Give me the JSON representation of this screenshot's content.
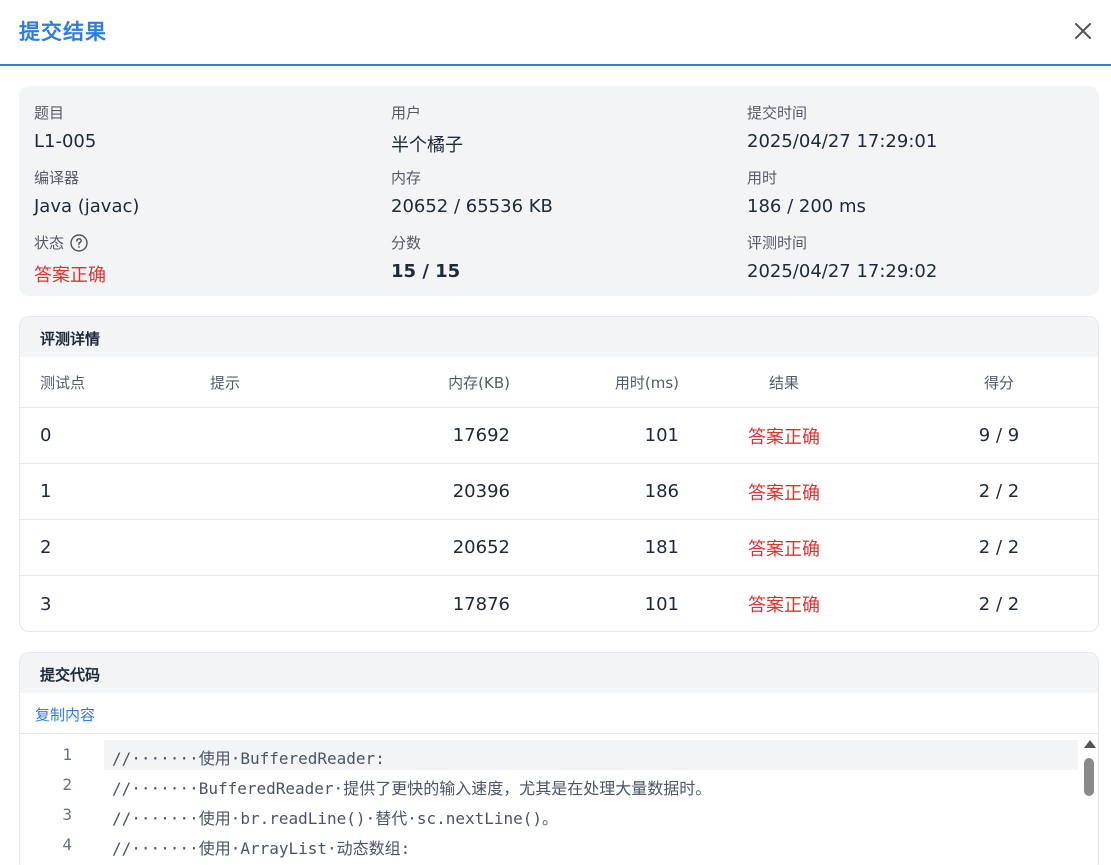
{
  "header": {
    "title": "提交结果",
    "close_icon": "close-icon"
  },
  "info": {
    "problem": {
      "label": "题目",
      "value": "L1-005"
    },
    "user": {
      "label": "用户",
      "value": "半个橘子"
    },
    "submit_time": {
      "label": "提交时间",
      "value": "2025/04/27 17:29:01"
    },
    "compiler": {
      "label": "编译器",
      "value": "Java (javac)"
    },
    "memory": {
      "label": "内存",
      "value": "20652 / 65536 KB"
    },
    "time_used": {
      "label": "用时",
      "value": "186 / 200 ms"
    },
    "status": {
      "label": "状态",
      "value": "答案正确",
      "help_icon": "help-icon"
    },
    "score": {
      "label": "分数",
      "value": "15 / 15"
    },
    "judge_time": {
      "label": "评测时间",
      "value": "2025/04/27 17:29:02"
    }
  },
  "judge_details": {
    "title": "评测详情",
    "headers": {
      "case": "测试点",
      "hint": "提示",
      "memory": "内存(KB)",
      "time": "用时(ms)",
      "result": "结果",
      "score": "得分"
    },
    "rows": [
      {
        "case": "0",
        "hint": "",
        "memory": "17692",
        "time": "101",
        "result": "答案正确",
        "score": "9 / 9"
      },
      {
        "case": "1",
        "hint": "",
        "memory": "20396",
        "time": "186",
        "result": "答案正确",
        "score": "2 / 2"
      },
      {
        "case": "2",
        "hint": "",
        "memory": "20652",
        "time": "181",
        "result": "答案正确",
        "score": "2 / 2"
      },
      {
        "case": "3",
        "hint": "",
        "memory": "17876",
        "time": "101",
        "result": "答案正确",
        "score": "2 / 2"
      }
    ]
  },
  "code": {
    "title": "提交代码",
    "copy_label": "复制内容",
    "lines": [
      {
        "num": "1",
        "text": "//·······使用·BufferedReader:"
      },
      {
        "num": "2",
        "text": "//·······BufferedReader·提供了更快的输入速度，尤其是在处理大量数据时。"
      },
      {
        "num": "3",
        "text": "//·······使用·br.readLine()·替代·sc.nextLine()。"
      },
      {
        "num": "4",
        "text": "//·······使用·ArrayList·动态数组:"
      }
    ]
  },
  "colors": {
    "accent": "#2f7de1",
    "success_text": "#e03131",
    "card_bg": "#f3f4f6"
  }
}
